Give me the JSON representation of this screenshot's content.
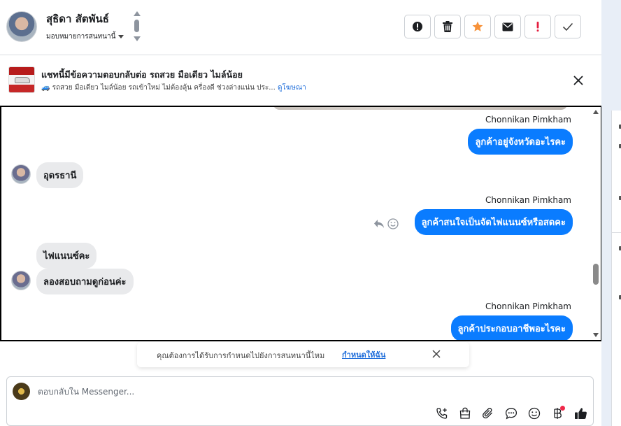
{
  "header": {
    "contact_name": "สุธิดา สัตพันธ์",
    "assign_label": "มอบหมายการสนทนานี้",
    "actions": [
      {
        "name": "report-spam-icon"
      },
      {
        "name": "trash-icon"
      },
      {
        "name": "star-icon"
      },
      {
        "name": "mark-unread-icon"
      },
      {
        "name": "important-icon"
      },
      {
        "name": "check-icon"
      }
    ]
  },
  "ad_banner": {
    "title": "แชทนี้มีข้อความตอบกลับต่อ รถสวย มือเดียว ไมล์น้อย",
    "subtitle": "🚙 รถสวย มือเดียว ไมล์น้อย รถเข้าใหม่ ไม่ต้องลุ้น ครื่องดี ช่วงล่างแน่น ประ...",
    "link": "ดูโฆษณา"
  },
  "messages": [
    {
      "sender": "Chonnikan Pimkham",
      "text": "ลูกค้าอยู่จังหวัดอะไรคะ",
      "outgoing": true
    },
    {
      "text": "อุดรธานี",
      "outgoing": false
    },
    {
      "sender": "Chonnikan Pimkham",
      "text": "ลูกค้าสนใจเป็นจัดไฟแนนซ์หรือสดคะ",
      "outgoing": true
    },
    {
      "text": "ไฟแนนซ์คะ",
      "outgoing": false
    },
    {
      "text": "ลองสอบถามดูก่อนค่ะ",
      "outgoing": false
    },
    {
      "sender": "Chonnikan Pimkham",
      "text": "ลูกค้าประกอบอาชีพอะไรคะ",
      "outgoing": true
    }
  ],
  "toast": {
    "text": "คุณต้องการได้รับการกำหนดไปยังการสนทนานี้ไหม",
    "link": "กำหนดให้ฉัน"
  },
  "composer": {
    "placeholder": "ตอบกลับใน Messenger..."
  },
  "colors": {
    "outgoing_bubble": "#0a7cff",
    "incoming_bubble": "#e9eaec",
    "star": "#f7923a",
    "important": "#e41e3f",
    "link": "#216fdb"
  }
}
